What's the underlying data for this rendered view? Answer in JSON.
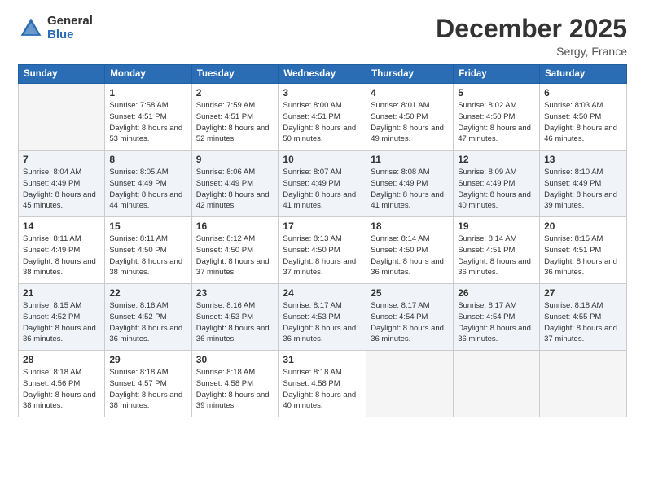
{
  "header": {
    "logo_general": "General",
    "logo_blue": "Blue",
    "month_title": "December 2025",
    "subtitle": "Sergy, France"
  },
  "calendar": {
    "days_of_week": [
      "Sunday",
      "Monday",
      "Tuesday",
      "Wednesday",
      "Thursday",
      "Friday",
      "Saturday"
    ],
    "weeks": [
      [
        {
          "day": "",
          "sunrise": "",
          "sunset": "",
          "daylight": "",
          "empty": true
        },
        {
          "day": "1",
          "sunrise": "Sunrise: 7:58 AM",
          "sunset": "Sunset: 4:51 PM",
          "daylight": "Daylight: 8 hours and 53 minutes."
        },
        {
          "day": "2",
          "sunrise": "Sunrise: 7:59 AM",
          "sunset": "Sunset: 4:51 PM",
          "daylight": "Daylight: 8 hours and 52 minutes."
        },
        {
          "day": "3",
          "sunrise": "Sunrise: 8:00 AM",
          "sunset": "Sunset: 4:51 PM",
          "daylight": "Daylight: 8 hours and 50 minutes."
        },
        {
          "day": "4",
          "sunrise": "Sunrise: 8:01 AM",
          "sunset": "Sunset: 4:50 PM",
          "daylight": "Daylight: 8 hours and 49 minutes."
        },
        {
          "day": "5",
          "sunrise": "Sunrise: 8:02 AM",
          "sunset": "Sunset: 4:50 PM",
          "daylight": "Daylight: 8 hours and 47 minutes."
        },
        {
          "day": "6",
          "sunrise": "Sunrise: 8:03 AM",
          "sunset": "Sunset: 4:50 PM",
          "daylight": "Daylight: 8 hours and 46 minutes."
        }
      ],
      [
        {
          "day": "7",
          "sunrise": "Sunrise: 8:04 AM",
          "sunset": "Sunset: 4:49 PM",
          "daylight": "Daylight: 8 hours and 45 minutes."
        },
        {
          "day": "8",
          "sunrise": "Sunrise: 8:05 AM",
          "sunset": "Sunset: 4:49 PM",
          "daylight": "Daylight: 8 hours and 44 minutes."
        },
        {
          "day": "9",
          "sunrise": "Sunrise: 8:06 AM",
          "sunset": "Sunset: 4:49 PM",
          "daylight": "Daylight: 8 hours and 42 minutes."
        },
        {
          "day": "10",
          "sunrise": "Sunrise: 8:07 AM",
          "sunset": "Sunset: 4:49 PM",
          "daylight": "Daylight: 8 hours and 41 minutes."
        },
        {
          "day": "11",
          "sunrise": "Sunrise: 8:08 AM",
          "sunset": "Sunset: 4:49 PM",
          "daylight": "Daylight: 8 hours and 41 minutes."
        },
        {
          "day": "12",
          "sunrise": "Sunrise: 8:09 AM",
          "sunset": "Sunset: 4:49 PM",
          "daylight": "Daylight: 8 hours and 40 minutes."
        },
        {
          "day": "13",
          "sunrise": "Sunrise: 8:10 AM",
          "sunset": "Sunset: 4:49 PM",
          "daylight": "Daylight: 8 hours and 39 minutes."
        }
      ],
      [
        {
          "day": "14",
          "sunrise": "Sunrise: 8:11 AM",
          "sunset": "Sunset: 4:49 PM",
          "daylight": "Daylight: 8 hours and 38 minutes."
        },
        {
          "day": "15",
          "sunrise": "Sunrise: 8:11 AM",
          "sunset": "Sunset: 4:50 PM",
          "daylight": "Daylight: 8 hours and 38 minutes."
        },
        {
          "day": "16",
          "sunrise": "Sunrise: 8:12 AM",
          "sunset": "Sunset: 4:50 PM",
          "daylight": "Daylight: 8 hours and 37 minutes."
        },
        {
          "day": "17",
          "sunrise": "Sunrise: 8:13 AM",
          "sunset": "Sunset: 4:50 PM",
          "daylight": "Daylight: 8 hours and 37 minutes."
        },
        {
          "day": "18",
          "sunrise": "Sunrise: 8:14 AM",
          "sunset": "Sunset: 4:50 PM",
          "daylight": "Daylight: 8 hours and 36 minutes."
        },
        {
          "day": "19",
          "sunrise": "Sunrise: 8:14 AM",
          "sunset": "Sunset: 4:51 PM",
          "daylight": "Daylight: 8 hours and 36 minutes."
        },
        {
          "day": "20",
          "sunrise": "Sunrise: 8:15 AM",
          "sunset": "Sunset: 4:51 PM",
          "daylight": "Daylight: 8 hours and 36 minutes."
        }
      ],
      [
        {
          "day": "21",
          "sunrise": "Sunrise: 8:15 AM",
          "sunset": "Sunset: 4:52 PM",
          "daylight": "Daylight: 8 hours and 36 minutes."
        },
        {
          "day": "22",
          "sunrise": "Sunrise: 8:16 AM",
          "sunset": "Sunset: 4:52 PM",
          "daylight": "Daylight: 8 hours and 36 minutes."
        },
        {
          "day": "23",
          "sunrise": "Sunrise: 8:16 AM",
          "sunset": "Sunset: 4:53 PM",
          "daylight": "Daylight: 8 hours and 36 minutes."
        },
        {
          "day": "24",
          "sunrise": "Sunrise: 8:17 AM",
          "sunset": "Sunset: 4:53 PM",
          "daylight": "Daylight: 8 hours and 36 minutes."
        },
        {
          "day": "25",
          "sunrise": "Sunrise: 8:17 AM",
          "sunset": "Sunset: 4:54 PM",
          "daylight": "Daylight: 8 hours and 36 minutes."
        },
        {
          "day": "26",
          "sunrise": "Sunrise: 8:17 AM",
          "sunset": "Sunset: 4:54 PM",
          "daylight": "Daylight: 8 hours and 36 minutes."
        },
        {
          "day": "27",
          "sunrise": "Sunrise: 8:18 AM",
          "sunset": "Sunset: 4:55 PM",
          "daylight": "Daylight: 8 hours and 37 minutes."
        }
      ],
      [
        {
          "day": "28",
          "sunrise": "Sunrise: 8:18 AM",
          "sunset": "Sunset: 4:56 PM",
          "daylight": "Daylight: 8 hours and 38 minutes."
        },
        {
          "day": "29",
          "sunrise": "Sunrise: 8:18 AM",
          "sunset": "Sunset: 4:57 PM",
          "daylight": "Daylight: 8 hours and 38 minutes."
        },
        {
          "day": "30",
          "sunrise": "Sunrise: 8:18 AM",
          "sunset": "Sunset: 4:58 PM",
          "daylight": "Daylight: 8 hours and 39 minutes."
        },
        {
          "day": "31",
          "sunrise": "Sunrise: 8:18 AM",
          "sunset": "Sunset: 4:58 PM",
          "daylight": "Daylight: 8 hours and 40 minutes."
        },
        {
          "day": "",
          "sunrise": "",
          "sunset": "",
          "daylight": "",
          "empty": true
        },
        {
          "day": "",
          "sunrise": "",
          "sunset": "",
          "daylight": "",
          "empty": true
        },
        {
          "day": "",
          "sunrise": "",
          "sunset": "",
          "daylight": "",
          "empty": true
        }
      ]
    ]
  }
}
